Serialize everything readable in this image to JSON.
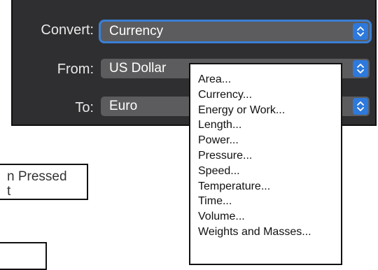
{
  "converter": {
    "convert_label": "Convert:",
    "convert_value": "Currency",
    "from_label": "From:",
    "from_value": "US Dollar",
    "to_label": "To:",
    "to_value": "Euro"
  },
  "menu": {
    "items": [
      "Area...",
      "Currency...",
      "Energy or Work...",
      "Length...",
      "Power...",
      "Pressure...",
      "Speed...",
      "Temperature...",
      "Time...",
      "Volume...",
      "Weights and Masses..."
    ]
  },
  "background_text": {
    "line1": "n Pressed",
    "line2": "t"
  },
  "colors": {
    "panel_bg": "#2f2f31",
    "select_bg": "#5c5c5e",
    "accent": "#2d79dc",
    "focus_ring": "#3a7fd5"
  },
  "icons": {
    "stepper": "up-down-chevron-icon"
  }
}
